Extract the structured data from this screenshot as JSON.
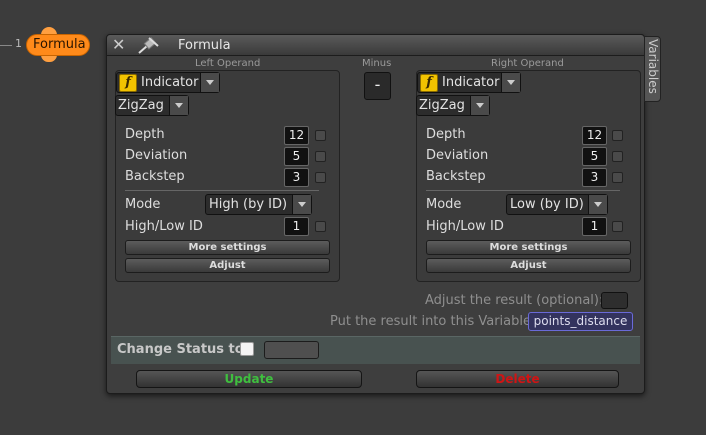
{
  "node": {
    "number": "1",
    "label": "Formula"
  },
  "window": {
    "title": "Formula",
    "side_tab": "Variables"
  },
  "operator": {
    "caption": "Minus",
    "symbol": "-"
  },
  "left": {
    "caption": "Left Operand",
    "type": "Indicator",
    "indicator": "ZigZag",
    "rows": {
      "depth_label": "Depth",
      "depth": "12",
      "deviation_label": "Deviation",
      "deviation": "5",
      "backstep_label": "Backstep",
      "backstep": "3"
    },
    "mode_label": "Mode",
    "mode": "High (by ID)",
    "id_label": "High/Low ID",
    "id": "1",
    "more_settings": "More settings",
    "adjust": "Adjust"
  },
  "right": {
    "caption": "Right Operand",
    "type": "Indicator",
    "indicator": "ZigZag",
    "rows": {
      "depth_label": "Depth",
      "depth": "12",
      "deviation_label": "Deviation",
      "deviation": "5",
      "backstep_label": "Backstep",
      "backstep": "3"
    },
    "mode_label": "Mode",
    "mode": "Low (by ID)",
    "id_label": "High/Low ID",
    "id": "1",
    "more_settings": "More settings",
    "adjust": "Adjust"
  },
  "result": {
    "adjust_label": "Adjust the result (optional):",
    "variable_label": "Put the result into this Variable:",
    "variable": "points_distance"
  },
  "status": {
    "label": "Change Status to"
  },
  "actions": {
    "update": "Update",
    "delete": "Delete"
  },
  "colors": {
    "update": "#3fbf3f",
    "delete": "#d01414",
    "node": "#ff8a1a",
    "variable": "#6a6ad8"
  }
}
